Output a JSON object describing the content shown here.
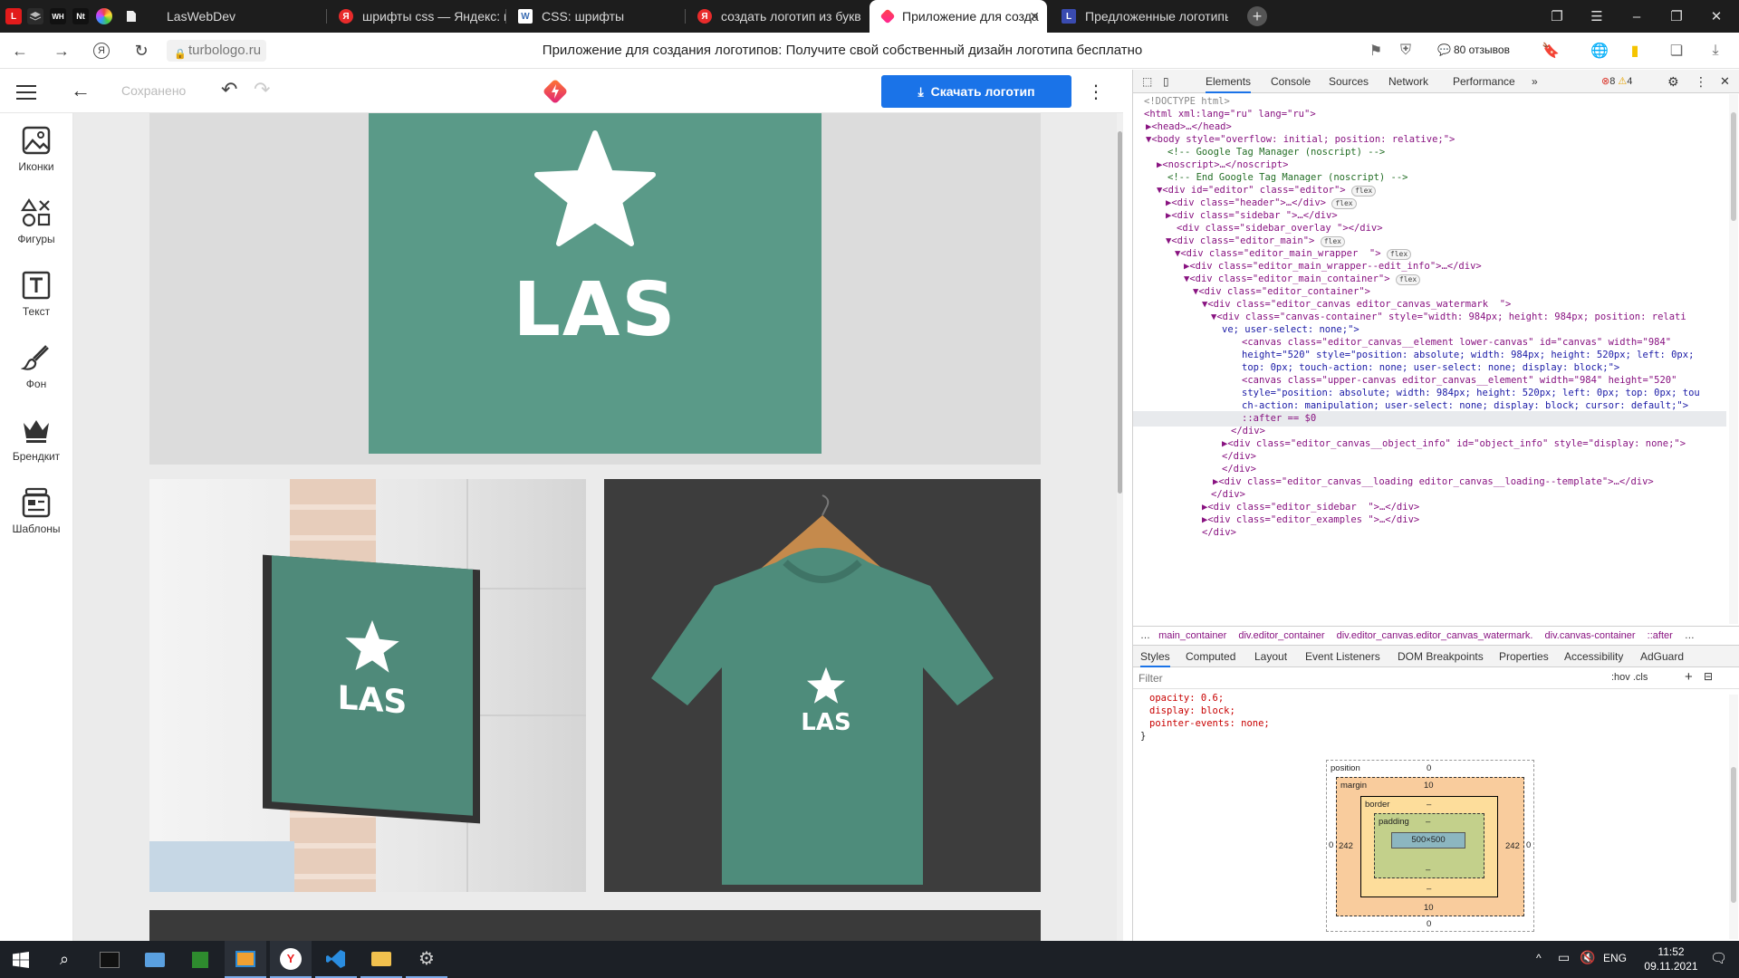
{
  "browser": {
    "tabs": [
      {
        "title": "LasWebDev"
      },
      {
        "title": "шрифты css — Яндекс: на"
      },
      {
        "title": "CSS: шрифты"
      },
      {
        "title": "создать логотип из букв о"
      },
      {
        "title": "Приложение для созда"
      },
      {
        "title": "Предложенные логотипы"
      }
    ],
    "pinned": [
      "L",
      "WH",
      "Nt"
    ],
    "url": "turbologo.ru",
    "page_title": "Приложение для создания логотипов: Получите свой собственный дизайн логотипа бесплатно",
    "reviews": "80 отзывов"
  },
  "editor": {
    "saved_label": "Сохранено",
    "download_label": "Скачать логотип",
    "sidebar": [
      {
        "label": "Иконки",
        "icon": "image-icon"
      },
      {
        "label": "Фигуры",
        "icon": "shapes-icon"
      },
      {
        "label": "Текст",
        "icon": "text-icon"
      },
      {
        "label": "Фон",
        "icon": "brush-icon"
      },
      {
        "label": "Брендкит",
        "icon": "crown-icon"
      },
      {
        "label": "Шаблоны",
        "icon": "templates-icon"
      }
    ],
    "logo_text": "LAS",
    "brand_color": "#5a9a88",
    "accent_color": "#1a73e8"
  },
  "devtools": {
    "tabs": [
      "Elements",
      "Console",
      "Sources",
      "Network",
      "Performance"
    ],
    "errors": "8",
    "warnings": "4",
    "breadcrumbs": [
      "…",
      "main_container",
      "div.editor_container",
      "div.editor_canvas.editor_canvas_watermark.",
      "div.canvas-container",
      "::after",
      "…"
    ],
    "subtabs": [
      "Styles",
      "Computed",
      "Layout",
      "Event Listeners",
      "DOM Breakpoints",
      "Properties",
      "Accessibility",
      "AdGuard"
    ],
    "filter_placeholder": "Filter",
    "filter_tools": ":hov .cls",
    "css_lines": [
      "opacity: 0.6;",
      "display: block;",
      "pointer-events: none;",
      "}"
    ],
    "box_model": {
      "position_label": "position",
      "margin_label": "margin",
      "border_label": "border",
      "padding_label": "padding",
      "position": "0",
      "margin_top": "10",
      "margin_bottom": "10",
      "margin_side": "242",
      "border": "–",
      "padding": "–",
      "position_side": "0",
      "content": "500×500"
    },
    "dom_lines": [
      "<!DOCTYPE html>",
      "<html xml:lang=\"ru\" lang=\"ru\">",
      "▶<head>…</head>",
      "▼<body style=\"overflow: initial; position: relative;\">",
      "<!-- Google Tag Manager (noscript) -->",
      "▶<noscript>…</noscript>",
      "<!-- End Google Tag Manager (noscript) -->",
      "▼<div id=\"editor\" class=\"editor\">",
      "▶<div class=\"header\">…</div>",
      "▶<div class=\"sidebar \">…</div>",
      "<div class=\"sidebar_overlay \"></div>",
      "▼<div class=\"editor_main\">",
      "▼<div class=\"editor_main_wrapper  \">",
      "▶<div class=\"editor_main_wrapper--edit_info\">…</div>",
      "▼<div class=\"editor_main_container\">",
      "▼<div class=\"editor_container\">",
      "▼<div class=\"editor_canvas editor_canvas_watermark  \">",
      "▼<div class=\"canvas-container\" style=\"width: 984px; height: 984px; position: relati",
      "ve; user-select: none;\">",
      "<canvas class=\"editor_canvas__element lower-canvas\" id=\"canvas\" width=\"984\"",
      "height=\"520\" style=\"position: absolute; width: 984px; height: 520px; left: 0px;",
      "top: 0px; touch-action: none; user-select: none; display: block;\">",
      "<canvas class=\"upper-canvas editor_canvas__element\" width=\"984\" height=\"520\"",
      "style=\"position: absolute; width: 984px; height: 520px; left: 0px; top: 0px; tou",
      "ch-action: manipulation; user-select: none; display: block; cursor: default;\">",
      "::after == $0",
      "</div>",
      "▶<div class=\"editor_canvas__object_info\" id=\"object_info\" style=\"display: none;\">",
      "</div>",
      "</div>",
      "▶<div class=\"editor_canvas__loading editor_canvas__loading--template\">…</div>",
      "</div>",
      "▶<div class=\"editor_sidebar  \">…</div>",
      "▶<div class=\"editor_examples \">…</div>",
      "</div>"
    ],
    "flex_badge": "flex"
  },
  "taskbar": {
    "lang": "ENG",
    "time": "11:52",
    "date": "09.11.2021"
  }
}
